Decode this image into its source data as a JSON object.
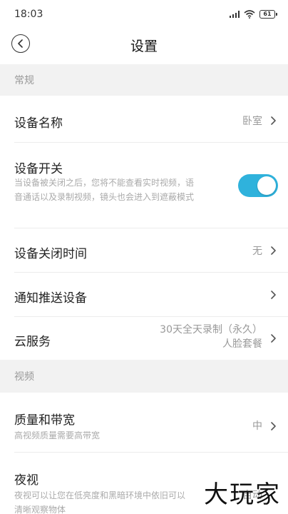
{
  "status_bar": {
    "time": "18:03",
    "battery": "61"
  },
  "nav": {
    "title": "设置"
  },
  "sections": {
    "general": "常规",
    "video": "视频"
  },
  "rows": {
    "device_name": {
      "title": "设备名称",
      "value": "卧室"
    },
    "device_switch": {
      "title": "设备开关",
      "desc_line1": "当设备被关闭之后，您将不能查看实时视频，语",
      "desc_line2": "音通话以及录制视频，镜头也会进入到遮蔽模式",
      "enabled": true
    },
    "device_off_time": {
      "title": "设备关闭时间",
      "value": "无"
    },
    "notify_device": {
      "title": "通知推送设备"
    },
    "cloud_service": {
      "title": "云服务",
      "value_line1": "30天全天录制（永久）",
      "value_line2": "人脸套餐"
    },
    "quality": {
      "title": "质量和带宽",
      "desc": "高视频质量需要高带宽",
      "value": "中"
    },
    "night_vision": {
      "title": "夜视",
      "desc_line1": "夜视可以让您在低亮度和黑暗环境中依旧可以",
      "desc_line2": "清晰观察物体",
      "value": "自动"
    }
  },
  "watermark": "大玩家",
  "colors": {
    "accent": "#2fb2dc",
    "section_bg": "#f2f2f2"
  }
}
